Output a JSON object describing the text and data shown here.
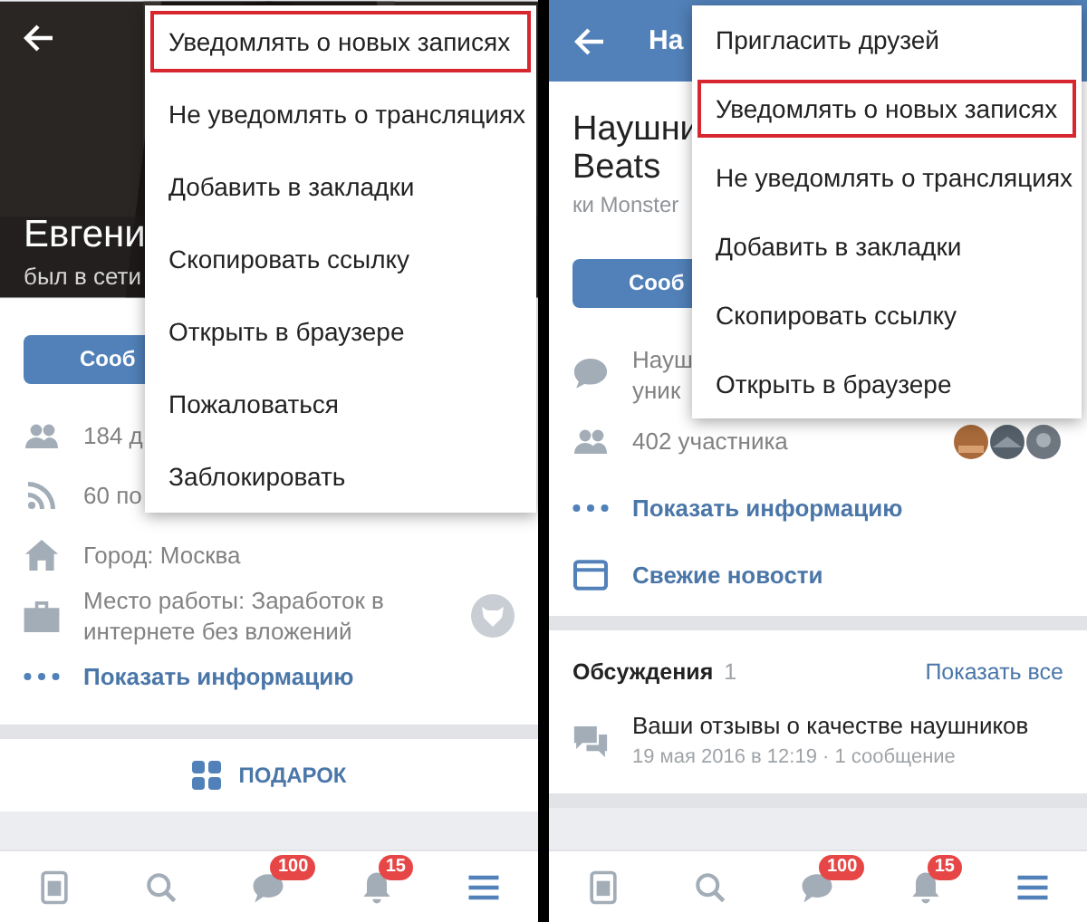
{
  "screens": [
    {
      "kind": "profile",
      "header": {
        "name": "Евгени",
        "status": "был в сети"
      },
      "message_button": "Сооб",
      "info_rows": [
        {
          "kind": "friends",
          "lines": [
            "184 д"
          ],
          "link": false
        },
        {
          "kind": "feed",
          "lines": [
            "60 по"
          ],
          "link": false
        },
        {
          "kind": "home",
          "lines": [
            "Город: Москва"
          ],
          "link": false
        },
        {
          "kind": "work",
          "lines": [
            "Место работы: Заработок в",
            "интернете без вложений"
          ],
          "link": false,
          "logo": true
        },
        {
          "kind": "more",
          "lines": [
            "Показать информацию"
          ],
          "link": true
        }
      ],
      "gift": "ПОДАРОК",
      "menu": [
        {
          "label": "Уведомлять о новых записях",
          "highlighted": true
        },
        {
          "label": "Не уведомлять о трансляциях",
          "highlighted": false
        },
        {
          "label": "Добавить в закладки",
          "highlighted": false
        },
        {
          "label": "Скопировать ссылку",
          "highlighted": false
        },
        {
          "label": "Открыть в браузере",
          "highlighted": false
        },
        {
          "label": "Пожаловаться",
          "highlighted": false
        },
        {
          "label": "Заблокировать",
          "highlighted": false
        }
      ],
      "nav": [
        {
          "kind": "news",
          "selected": false
        },
        {
          "kind": "search",
          "selected": false
        },
        {
          "kind": "messages",
          "selected": false,
          "badge": "100"
        },
        {
          "kind": "notifications",
          "selected": false,
          "badge": "15"
        },
        {
          "kind": "menu",
          "selected": true
        }
      ]
    },
    {
      "kind": "community",
      "header": {
        "kind": "bar",
        "title": "На"
      },
      "title_lines": [
        "Наушни",
        "Beats"
      ],
      "subtitle": "ки Monster",
      "message_button": "Сооб",
      "info_rows": [
        {
          "kind": "chat",
          "lines": [
            "Науш",
            "уник"
          ],
          "link": false
        },
        {
          "kind": "members",
          "lines": [
            "402 участника"
          ],
          "link": false,
          "avatars": true
        },
        {
          "kind": "more",
          "lines": [
            "Показать информацию"
          ],
          "link": true
        },
        {
          "kind": "news",
          "lines": [
            "Свежие новости"
          ],
          "link": true
        }
      ],
      "discussions": {
        "title": "Обсуждения",
        "count": "1",
        "action": "Показать все",
        "items": [
          {
            "title": "Ваши отзывы о качестве наушников",
            "meta": "19 мая 2016 в 12:19 · 1 сообщение"
          }
        ]
      },
      "menu": [
        {
          "label": "Пригласить друзей",
          "highlighted": false
        },
        {
          "label": "Уведомлять о новых записях",
          "highlighted": true
        },
        {
          "label": "Не уведомлять о трансляциях",
          "highlighted": false
        },
        {
          "label": "Добавить в закладки",
          "highlighted": false
        },
        {
          "label": "Скопировать ссылку",
          "highlighted": false
        },
        {
          "label": "Открыть в браузере",
          "highlighted": false
        }
      ],
      "nav": [
        {
          "kind": "news",
          "selected": false
        },
        {
          "kind": "search",
          "selected": false
        },
        {
          "kind": "messages",
          "selected": false,
          "badge": "100"
        },
        {
          "kind": "notifications",
          "selected": false,
          "badge": "15"
        },
        {
          "kind": "menu",
          "selected": true
        }
      ]
    }
  ]
}
